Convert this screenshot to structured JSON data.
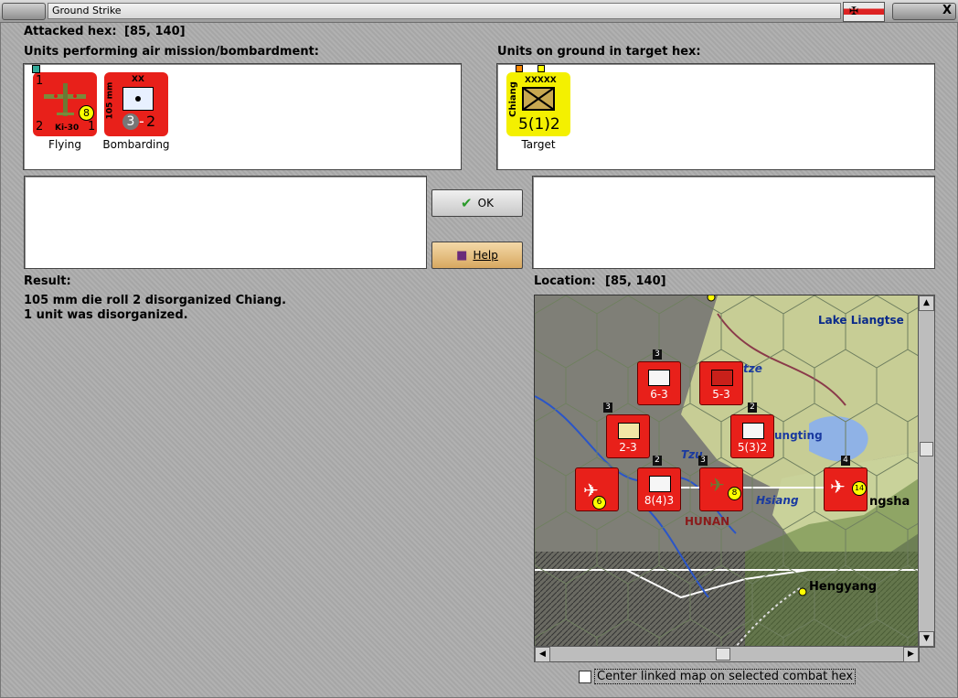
{
  "window": {
    "title": "Ground Strike",
    "close_glyph": "X"
  },
  "attacked_hex": {
    "label": "Attacked hex:",
    "coords": "[85, 140]"
  },
  "air_units": {
    "heading": "Units performing air mission/bombardment:",
    "units": [
      {
        "caption": "Flying",
        "top_left": "1",
        "bottom_left": "2",
        "bottom_right": "1",
        "name": "Ki-30",
        "badge": "8"
      },
      {
        "caption": "Bombarding",
        "side_label": "105 mm",
        "size": "XX",
        "strength_a": "3",
        "strength_b": "2"
      }
    ]
  },
  "ground_units": {
    "heading": "Units on ground in target hex:",
    "units": [
      {
        "caption": "Target",
        "side_label": "Chiang",
        "size": "XXXXX",
        "strength": "5(1)2"
      }
    ]
  },
  "buttons": {
    "ok_label": "OK",
    "help_label": "Help"
  },
  "result": {
    "heading": "Result:",
    "lines": [
      "105 mm die roll 2 disorganized Chiang.",
      "1 unit was disorganized."
    ]
  },
  "location": {
    "label": "Location:",
    "coords": "[85, 140]"
  },
  "map": {
    "places": [
      "Lake Liangtse",
      "Tzu",
      "Hsiang",
      "HUNAN",
      "Hengyang",
      "tze",
      "ungting",
      "ngsha"
    ],
    "counters": [
      {
        "strength": "6-3",
        "stack": "3"
      },
      {
        "strength": "5-3"
      },
      {
        "strength": "2-3",
        "stack": "3"
      },
      {
        "strength": "5(3)2",
        "stack": "2"
      },
      {
        "strength": "8(4)3",
        "stack": "2"
      },
      {
        "badge": "6"
      },
      {
        "badge": "8",
        "stack": "3"
      },
      {
        "badge": "14",
        "stack": "4"
      }
    ]
  },
  "footer": {
    "checkbox_label": "Center linked map on selected combat hex"
  }
}
